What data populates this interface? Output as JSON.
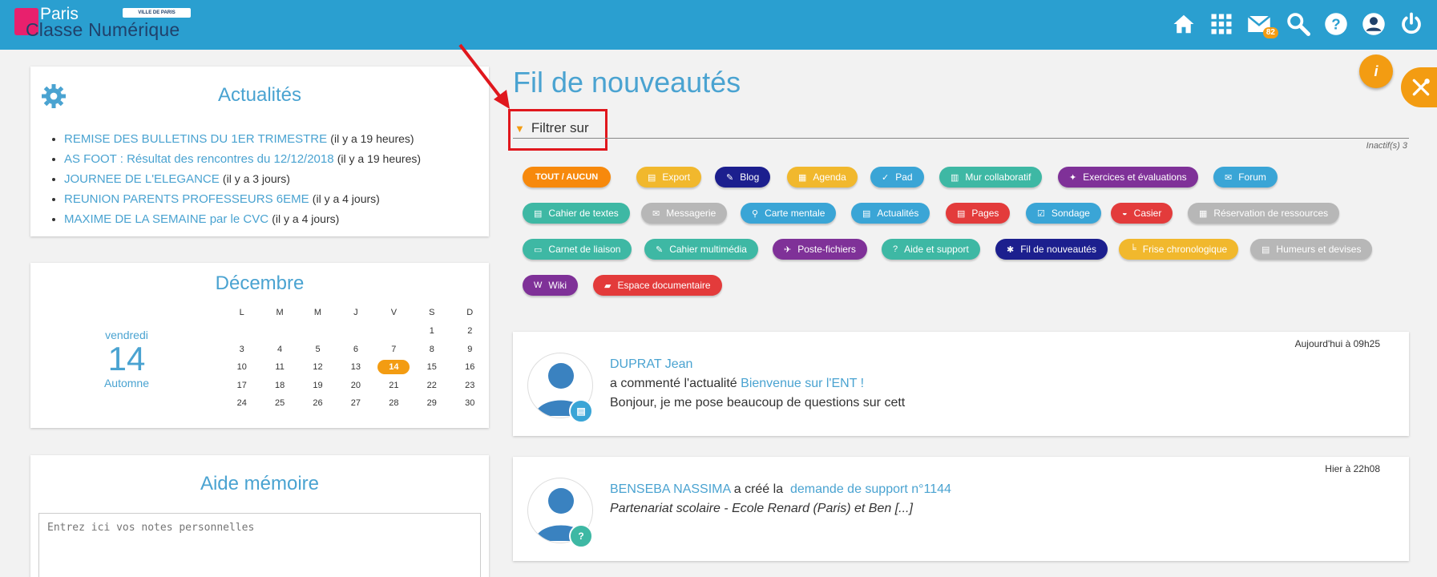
{
  "header": {
    "logo_paris": "Paris",
    "logo_classe": "Classe Numérique",
    "logo_ville": "VILLE DE PARIS",
    "mail_count": "82",
    "icons": [
      "home-icon",
      "apps-grid-icon",
      "mail-icon",
      "search-icon",
      "help-icon",
      "user-icon",
      "power-icon"
    ]
  },
  "news": {
    "title": "Actualités",
    "items": [
      {
        "label": "REMISE DES BULLETINS DU 1ER TRIMESTRE",
        "ago": "(il y a 19 heures)"
      },
      {
        "label": "AS FOOT : Résultat des rencontres du 12/12/2018",
        "ago": "(il y a 19 heures)"
      },
      {
        "label": "JOURNEE DE L'ELEGANCE",
        "ago": "(il y a 3 jours)"
      },
      {
        "label": "REUNION PARENTS PROFESSEURS 6EME",
        "ago": "(il y a 4 jours)"
      },
      {
        "label": "MAXIME DE LA SEMAINE par le CVC",
        "ago": "(il y a 4 jours)"
      }
    ]
  },
  "calendar": {
    "month": "Décembre",
    "weekday": "vendredi",
    "day": "14",
    "season": "Automne",
    "headers": [
      "L",
      "M",
      "M",
      "J",
      "V",
      "S",
      "D"
    ],
    "weeks": [
      [
        "",
        "",
        "",
        "",
        "",
        "1",
        "2"
      ],
      [
        "3",
        "4",
        "5",
        "6",
        "7",
        "8",
        "9"
      ],
      [
        "10",
        "11",
        "12",
        "13",
        "14",
        "15",
        "16"
      ],
      [
        "17",
        "18",
        "19",
        "20",
        "21",
        "22",
        "23"
      ],
      [
        "24",
        "25",
        "26",
        "27",
        "28",
        "29",
        "30"
      ]
    ],
    "today": "14"
  },
  "memo": {
    "title": "Aide mémoire",
    "placeholder": "Entrez ici vos notes personnelles"
  },
  "main": {
    "title": "Fil de nouveautés",
    "filter_label": "Filtrer sur",
    "inactive": "Inactif(s) 3"
  },
  "chips": [
    {
      "label": "TOUT  /  AUCUN",
      "color": "#f7890c",
      "icon": ""
    },
    {
      "label": "Export",
      "color": "#f1b82d",
      "icon": "▤"
    },
    {
      "label": "Blog",
      "color": "#1c1f8e",
      "icon": "✎"
    },
    {
      "label": "Agenda",
      "color": "#f1b82d",
      "icon": "▦"
    },
    {
      "label": "Pad",
      "color": "#3aa5d6",
      "icon": "✓"
    },
    {
      "label": "Mur collaboratif",
      "color": "#3eb8a4",
      "icon": "▥"
    },
    {
      "label": "Exercices et évaluations",
      "color": "#7f3198",
      "icon": "✦"
    },
    {
      "label": "Forum",
      "color": "#3aa5d6",
      "icon": "✉"
    },
    {
      "label": "Cahier de textes",
      "color": "#3eb8a4",
      "icon": "▤"
    },
    {
      "label": "Messagerie",
      "color": "#b7b7b7",
      "icon": "✉"
    },
    {
      "label": "Carte mentale",
      "color": "#3aa5d6",
      "icon": "⚲"
    },
    {
      "label": "Actualités",
      "color": "#3aa5d6",
      "icon": "▤"
    },
    {
      "label": "Pages",
      "color": "#e33b3b",
      "icon": "▤"
    },
    {
      "label": "Sondage",
      "color": "#3aa5d6",
      "icon": "☑"
    },
    {
      "label": "Casier",
      "color": "#e33b3b",
      "icon": "◒"
    },
    {
      "label": "Réservation de ressources",
      "color": "#b7b7b7",
      "icon": "▦"
    },
    {
      "label": "Carnet de liaison",
      "color": "#3eb8a4",
      "icon": "▭"
    },
    {
      "label": "Cahier multimédia",
      "color": "#3eb8a4",
      "icon": "✎"
    },
    {
      "label": "Poste-fichiers",
      "color": "#7f3198",
      "icon": "✈"
    },
    {
      "label": "Aide et support",
      "color": "#3eb8a4",
      "icon": "?"
    },
    {
      "label": "Fil de nouveautés",
      "color": "#1c1f8e",
      "icon": "✱"
    },
    {
      "label": "Frise chronologique",
      "color": "#f1b82d",
      "icon": "╘"
    },
    {
      "label": "Humeurs et devises",
      "color": "#b7b7b7",
      "icon": "▤"
    },
    {
      "label": "Wiki",
      "color": "#7f3198",
      "icon": "W"
    },
    {
      "label": "Espace documentaire",
      "color": "#e33b3b",
      "icon": "▰"
    }
  ],
  "feed": [
    {
      "time": "Aujourd'hui à 09h25",
      "author": "DUPRAT Jean",
      "action": "a commenté l'actualité",
      "target": "Bienvenue sur l'ENT !",
      "excerpt": "Bonjour, je me pose beaucoup de questions sur cett",
      "badge_color": "#3aa5d6",
      "badge_icon": "▤"
    },
    {
      "time": "Hier à 22h08",
      "author": "BENSEBA NASSIMA",
      "action": "a créé la",
      "target": "demande de support n°1144",
      "excerpt": "Partenariat scolaire - Ecole Renard (Paris) et Ben [...]",
      "badge_color": "#3eb8a4",
      "badge_icon": "?"
    }
  ],
  "floating": {
    "info_label": "i"
  }
}
